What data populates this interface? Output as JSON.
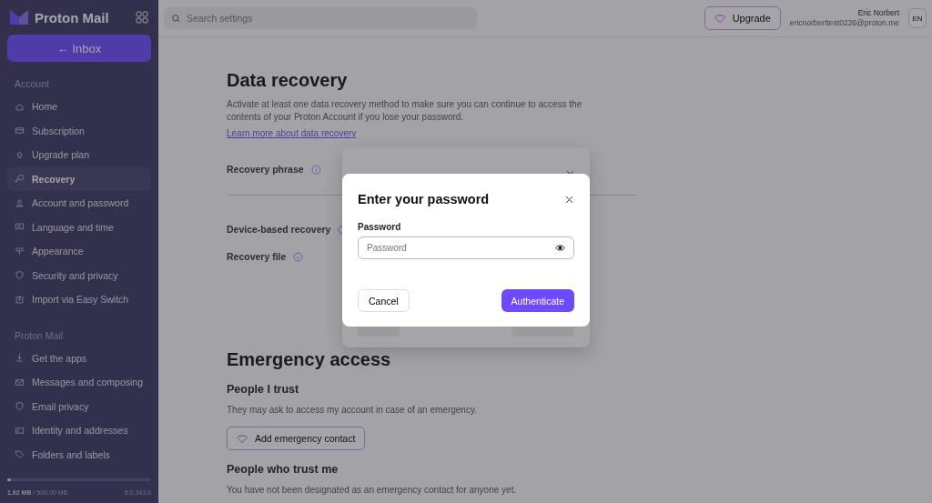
{
  "sidebar": {
    "brand": "Proton Mail",
    "inbox_button": "← Inbox",
    "sections": [
      {
        "heading": "Account",
        "items": [
          {
            "label": "Home",
            "selected": false
          },
          {
            "label": "Subscription",
            "selected": false
          },
          {
            "label": "Upgrade plan",
            "selected": false
          },
          {
            "label": "Recovery",
            "selected": true
          },
          {
            "label": "Account and password",
            "selected": false
          },
          {
            "label": "Language and time",
            "selected": false
          },
          {
            "label": "Appearance",
            "selected": false
          },
          {
            "label": "Security and privacy",
            "selected": false
          },
          {
            "label": "Import via Easy Switch",
            "selected": false
          }
        ]
      },
      {
        "heading": "Proton Mail",
        "items": [
          {
            "label": "Get the apps",
            "selected": false
          },
          {
            "label": "Messages and composing",
            "selected": false
          },
          {
            "label": "Email privacy",
            "selected": false
          },
          {
            "label": "Identity and addresses",
            "selected": false
          },
          {
            "label": "Folders and labels",
            "selected": false
          }
        ]
      }
    ],
    "storage": {
      "used": "1.62 MB",
      "total": "/ 500.00 MB",
      "level": 0.02,
      "version": "5.0.343.0"
    }
  },
  "topbar": {
    "search": {
      "placeholder": "Search settings"
    },
    "upgrade_button": "Upgrade",
    "user_name": "Eric Norbert",
    "user_email": "ericnorberttest0226@proton.me",
    "language": "EN"
  },
  "page": {
    "title": "Data recovery",
    "description": "Activate at least one data recovery method to make sure you can continue to access the contents of your Proton Account if you lose your password.",
    "link": "Learn more about data recovery",
    "settings": [
      {
        "label": "Recovery phrase"
      },
      {
        "label": "Device-based recovery"
      },
      {
        "label": "Recovery file"
      }
    ],
    "emergency": {
      "title": "Emergency access",
      "sections": [
        {
          "title": "People I trust",
          "text": "They may ask to access my account in case of an emergency.",
          "button": "Add emergency contact"
        },
        {
          "title": "People who trust me",
          "text": "You have not been designated as an emergency contact for anyone yet."
        }
      ]
    }
  },
  "modal": {
    "title": "Enter your password",
    "field_label": "Password",
    "placeholder": "Password",
    "cancel_button": "Cancel",
    "confirm_button": "Authenticate"
  }
}
